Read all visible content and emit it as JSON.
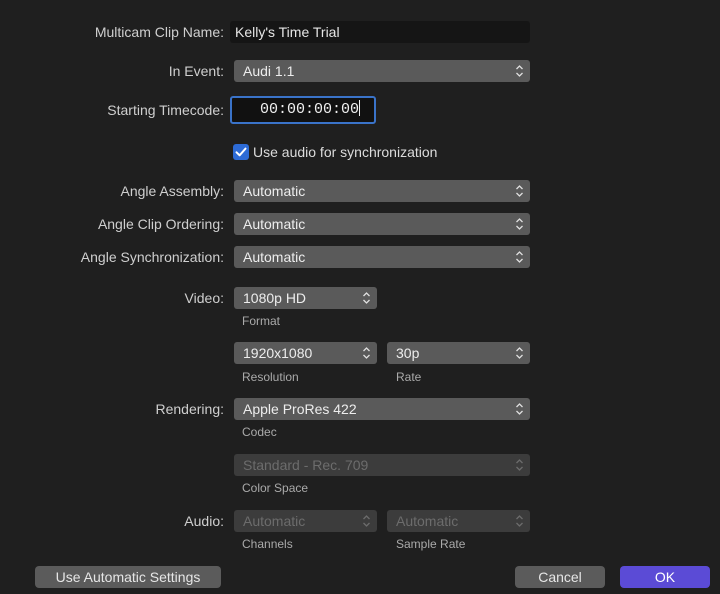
{
  "form": {
    "clip_name_label": "Multicam Clip Name:",
    "clip_name_value": "Kelly's Time Trial",
    "event_label": "In Event:",
    "event_value": "Audi 1.1",
    "timecode_label": "Starting Timecode:",
    "timecode_value": "00:00:00:00",
    "sync_audio_label": "Use audio for synchronization",
    "sync_audio_checked": true,
    "angle_assembly_label": "Angle Assembly:",
    "angle_assembly_value": "Automatic",
    "angle_ordering_label": "Angle Clip Ordering:",
    "angle_ordering_value": "Automatic",
    "angle_sync_label": "Angle Synchronization:",
    "angle_sync_value": "Automatic"
  },
  "video": {
    "label": "Video:",
    "format_value": "1080p HD",
    "format_caption": "Format",
    "resolution_value": "1920x1080",
    "resolution_caption": "Resolution",
    "rate_value": "30p",
    "rate_caption": "Rate"
  },
  "rendering": {
    "label": "Rendering:",
    "codec_value": "Apple ProRes 422",
    "codec_caption": "Codec",
    "color_space_value": "Standard - Rec. 709",
    "color_space_caption": "Color Space"
  },
  "audio": {
    "label": "Audio:",
    "channels_value": "Automatic",
    "channels_caption": "Channels",
    "sample_rate_value": "Automatic",
    "sample_rate_caption": "Sample Rate"
  },
  "buttons": {
    "auto_settings": "Use Automatic Settings",
    "cancel": "Cancel",
    "ok": "OK"
  },
  "colors": {
    "background": "#1f1f1f",
    "popup": "#5a5a5a",
    "accent_blue": "#2d6bd6",
    "ok_button": "#5b4bd6"
  }
}
